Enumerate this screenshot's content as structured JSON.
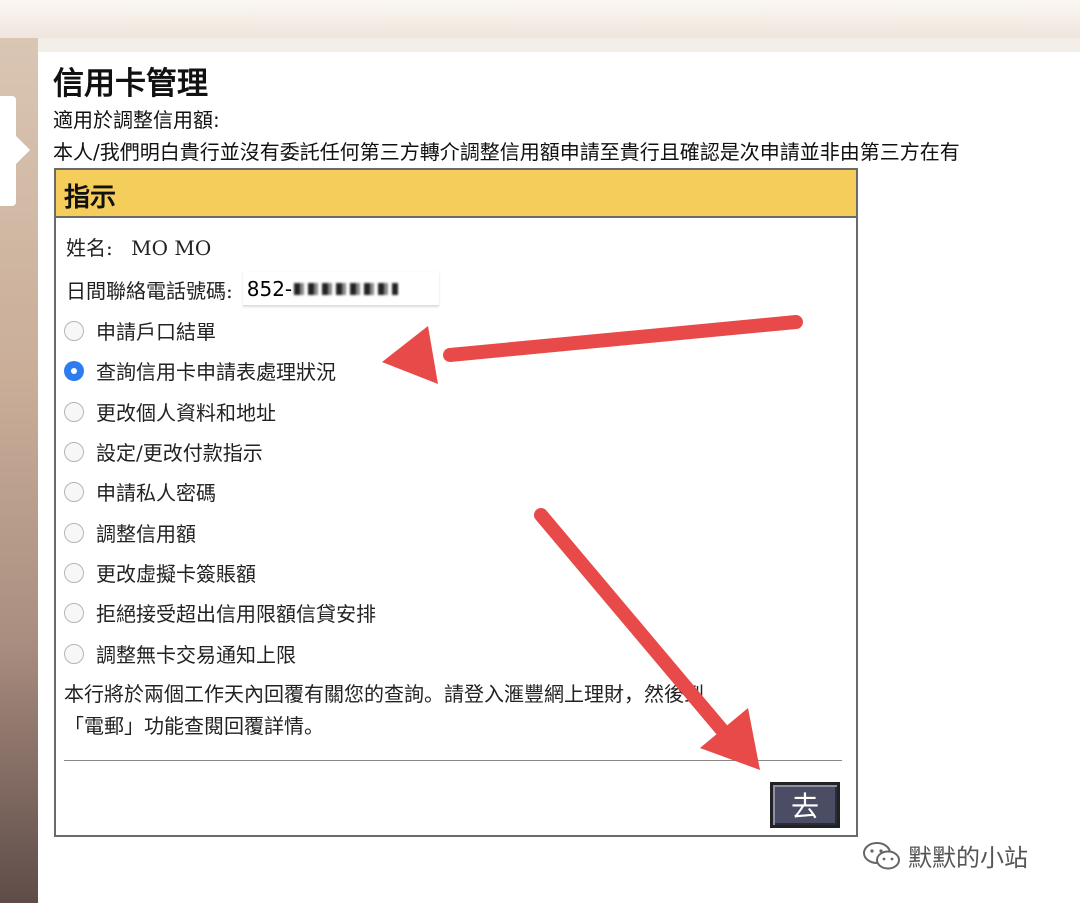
{
  "page": {
    "title": "信用卡管理",
    "line1": "適用於調整信用額:",
    "line2": "本人/我們明白貴行並沒有委託任何第三方轉介調整信用額申請至貴行且確認是次申請並非由第三方在有"
  },
  "form": {
    "header": "指示",
    "name_label": "姓名:",
    "name_value": "MO MO",
    "phone_label": "日間聯絡電話號碼:",
    "phone_value": "852-",
    "options": [
      {
        "label": "申請戶口結單",
        "checked": false
      },
      {
        "label": "查詢信用卡申請表處理狀況",
        "checked": true
      },
      {
        "label": "更改個人資料和地址",
        "checked": false
      },
      {
        "label": "設定/更改付款指示",
        "checked": false
      },
      {
        "label": "申請私人密碼",
        "checked": false
      },
      {
        "label": "調整信用額",
        "checked": false
      },
      {
        "label": "更改虛擬卡簽賬額",
        "checked": false
      },
      {
        "label": "拒絕接受超出信用限額信貸安排",
        "checked": false
      },
      {
        "label": "調整無卡交易通知上限",
        "checked": false
      }
    ],
    "note_line1": "本行將於兩個工作天內回覆有關您的查詢。請登入滙豐網上理財，然後到",
    "note_line2": "「電郵」功能查閱回覆詳情。",
    "go_label": "去"
  },
  "watermark": {
    "icon": "wechat-icon",
    "text": "默默的小站"
  },
  "colors": {
    "header_bg": "#f5cd5b",
    "arrow": "#e84a4a",
    "radio_checked": "#2f7bf0"
  }
}
